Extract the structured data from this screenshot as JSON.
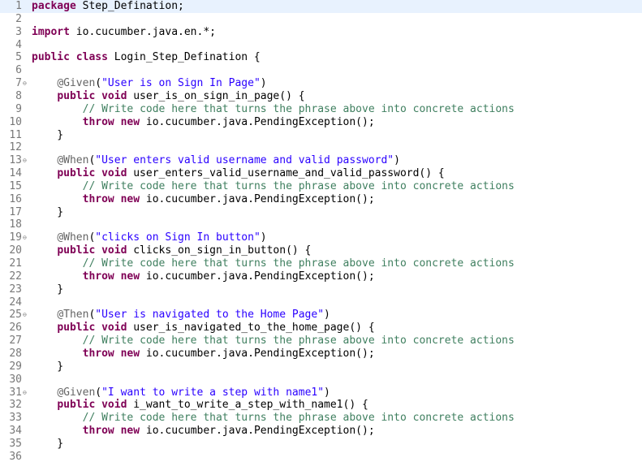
{
  "editor": {
    "lines": [
      [
        {
          "k": "kw",
          "t": "package"
        },
        {
          "k": "",
          "t": " Step_Defination;"
        }
      ],
      [],
      [
        {
          "k": "kw",
          "t": "import"
        },
        {
          "k": "",
          "t": " io.cucumber.java.en.*;"
        }
      ],
      [],
      [
        {
          "k": "kw",
          "t": "public class"
        },
        {
          "k": "",
          "t": " Login_Step_Defination {"
        }
      ],
      [],
      [
        {
          "k": "",
          "t": "    "
        },
        {
          "k": "ann",
          "t": "@Given"
        },
        {
          "k": "",
          "t": "("
        },
        {
          "k": "str",
          "t": "\"User is on Sign In Page\""
        },
        {
          "k": "",
          "t": ")"
        }
      ],
      [
        {
          "k": "",
          "t": "    "
        },
        {
          "k": "kw",
          "t": "public void"
        },
        {
          "k": "",
          "t": " user_is_on_sign_in_page() {"
        }
      ],
      [
        {
          "k": "",
          "t": "        "
        },
        {
          "k": "com",
          "t": "// Write code here that turns the phrase above into concrete actions"
        }
      ],
      [
        {
          "k": "",
          "t": "        "
        },
        {
          "k": "kw",
          "t": "throw new"
        },
        {
          "k": "",
          "t": " io.cucumber.java.PendingException();"
        }
      ],
      [
        {
          "k": "",
          "t": "    }"
        }
      ],
      [],
      [
        {
          "k": "",
          "t": "    "
        },
        {
          "k": "ann",
          "t": "@When"
        },
        {
          "k": "",
          "t": "("
        },
        {
          "k": "str",
          "t": "\"User enters valid username and valid password\""
        },
        {
          "k": "",
          "t": ")"
        }
      ],
      [
        {
          "k": "",
          "t": "    "
        },
        {
          "k": "kw",
          "t": "public void"
        },
        {
          "k": "",
          "t": " user_enters_valid_username_and_valid_password() {"
        }
      ],
      [
        {
          "k": "",
          "t": "        "
        },
        {
          "k": "com",
          "t": "// Write code here that turns the phrase above into concrete actions"
        }
      ],
      [
        {
          "k": "",
          "t": "        "
        },
        {
          "k": "kw",
          "t": "throw new"
        },
        {
          "k": "",
          "t": " io.cucumber.java.PendingException();"
        }
      ],
      [
        {
          "k": "",
          "t": "    }"
        }
      ],
      [],
      [
        {
          "k": "",
          "t": "    "
        },
        {
          "k": "ann",
          "t": "@When"
        },
        {
          "k": "",
          "t": "("
        },
        {
          "k": "str",
          "t": "\"clicks on Sign In button\""
        },
        {
          "k": "",
          "t": ")"
        }
      ],
      [
        {
          "k": "",
          "t": "    "
        },
        {
          "k": "kw",
          "t": "public void"
        },
        {
          "k": "",
          "t": " clicks_on_sign_in_button() {"
        }
      ],
      [
        {
          "k": "",
          "t": "        "
        },
        {
          "k": "com",
          "t": "// Write code here that turns the phrase above into concrete actions"
        }
      ],
      [
        {
          "k": "",
          "t": "        "
        },
        {
          "k": "kw",
          "t": "throw new"
        },
        {
          "k": "",
          "t": " io.cucumber.java.PendingException();"
        }
      ],
      [
        {
          "k": "",
          "t": "    }"
        }
      ],
      [],
      [
        {
          "k": "",
          "t": "    "
        },
        {
          "k": "ann",
          "t": "@Then"
        },
        {
          "k": "",
          "t": "("
        },
        {
          "k": "str",
          "t": "\"User is navigated to the Home Page\""
        },
        {
          "k": "",
          "t": ")"
        }
      ],
      [
        {
          "k": "",
          "t": "    "
        },
        {
          "k": "kw",
          "t": "public void"
        },
        {
          "k": "",
          "t": " user_is_navigated_to_the_home_page() {"
        }
      ],
      [
        {
          "k": "",
          "t": "        "
        },
        {
          "k": "com",
          "t": "// Write code here that turns the phrase above into concrete actions"
        }
      ],
      [
        {
          "k": "",
          "t": "        "
        },
        {
          "k": "kw",
          "t": "throw new"
        },
        {
          "k": "",
          "t": " io.cucumber.java.PendingException();"
        }
      ],
      [
        {
          "k": "",
          "t": "    }"
        }
      ],
      [],
      [
        {
          "k": "",
          "t": "    "
        },
        {
          "k": "ann",
          "t": "@Given"
        },
        {
          "k": "",
          "t": "("
        },
        {
          "k": "str",
          "t": "\"I want to write a step with name1\""
        },
        {
          "k": "",
          "t": ")"
        }
      ],
      [
        {
          "k": "",
          "t": "    "
        },
        {
          "k": "kw",
          "t": "public void"
        },
        {
          "k": "",
          "t": " i_want_to_write_a_step_with_name1() {"
        }
      ],
      [
        {
          "k": "",
          "t": "        "
        },
        {
          "k": "com",
          "t": "// Write code here that turns the phrase above into concrete actions"
        }
      ],
      [
        {
          "k": "",
          "t": "        "
        },
        {
          "k": "kw",
          "t": "throw new"
        },
        {
          "k": "",
          "t": " io.cucumber.java.PendingException();"
        }
      ],
      [
        {
          "k": "",
          "t": "    }"
        }
      ],
      []
    ],
    "fold_lines": [
      7,
      13,
      19,
      25,
      31
    ],
    "current_line": 1,
    "fold_icon": "fold-collapse-icon",
    "colors": {
      "keyword": "#7f0055",
      "string": "#2a00ff",
      "comment": "#3f7f5f",
      "annotation": "#646464",
      "line_number": "#787878",
      "current_line_bg": "#e8f2fe"
    }
  }
}
